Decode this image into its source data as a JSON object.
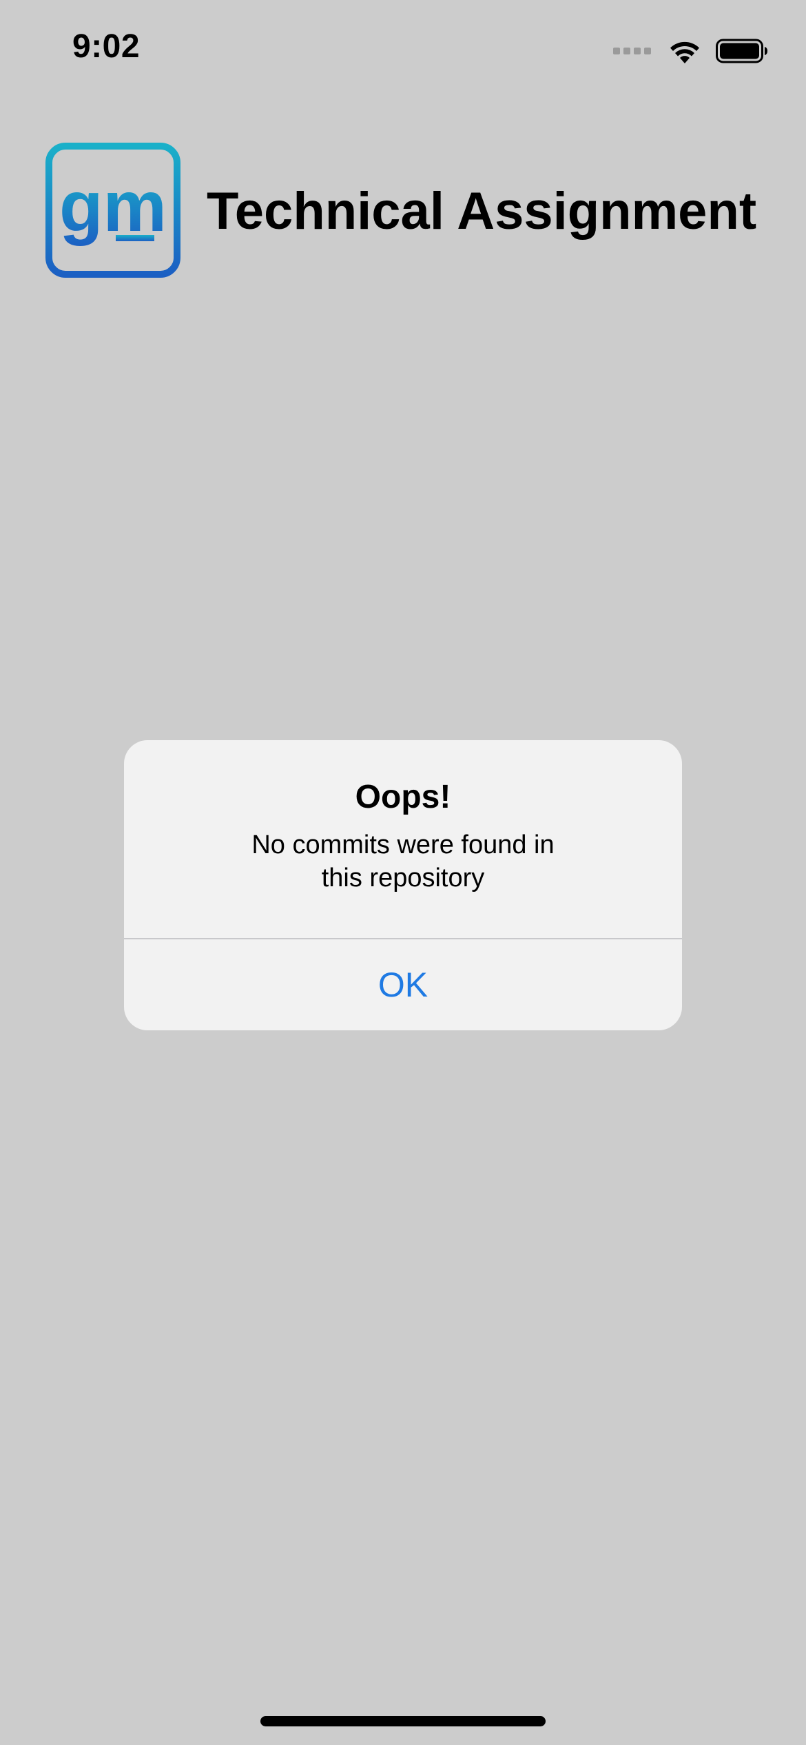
{
  "status_bar": {
    "time": "9:02",
    "signal_icon": "cellular-signal-icon",
    "wifi_icon": "wifi-icon",
    "battery_icon": "battery-icon",
    "battery_level": 1.0
  },
  "header": {
    "logo_text": "gm",
    "title": "Technical Assignment",
    "logo_colors": [
      "#1aa6c8",
      "#1b63c4"
    ]
  },
  "alert": {
    "title": "Oops!",
    "message_line1": "No commits were found in",
    "message_line2": "this repository",
    "ok_label": "OK",
    "accent_color": "#1f7ae3"
  }
}
